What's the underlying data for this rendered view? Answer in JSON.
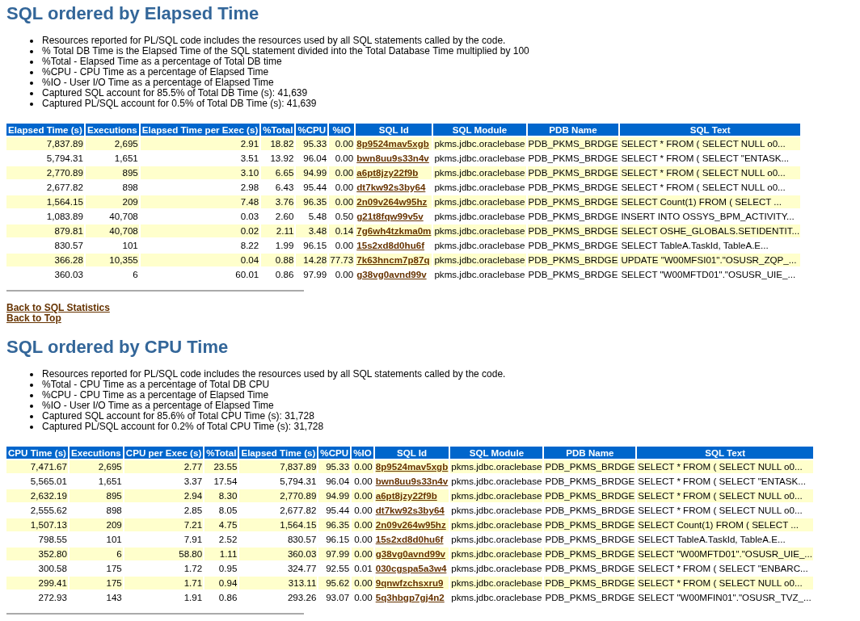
{
  "sections": [
    {
      "title": "SQL ordered by Elapsed Time",
      "notes": [
        "Resources reported for PL/SQL code includes the resources used by all SQL statements called by the code.",
        "% Total DB Time is the Elapsed Time of the SQL statement divided into the Total Database Time multiplied by 100",
        "%Total - Elapsed Time as a percentage of Total DB time",
        "%CPU - CPU Time as a percentage of Elapsed Time",
        "%IO - User I/O Time as a percentage of Elapsed Time",
        "Captured SQL account for 85.5% of Total DB Time (s): 41,639",
        "Captured PL/SQL account for 0.5% of Total DB Time (s): 41,639"
      ],
      "table": {
        "columns": [
          {
            "label": "Elapsed Time (s)",
            "kind": "number"
          },
          {
            "label": "Executions",
            "kind": "number"
          },
          {
            "label": "Elapsed Time per Exec (s)",
            "kind": "number"
          },
          {
            "label": "%Total",
            "kind": "number"
          },
          {
            "label": "%CPU",
            "kind": "number"
          },
          {
            "label": "%IO",
            "kind": "number"
          },
          {
            "label": "SQL Id",
            "kind": "link"
          },
          {
            "label": "SQL Module",
            "kind": "text"
          },
          {
            "label": "PDB Name",
            "kind": "text"
          },
          {
            "label": "SQL Text",
            "kind": "text"
          }
        ],
        "rows": [
          [
            "7,837.89",
            "2,695",
            "2.91",
            "18.82",
            "95.33",
            "0.00",
            "8p9524mav5xgb",
            "pkms.jdbc.oraclebase",
            "PDB_PKMS_BRDGE",
            "SELECT * FROM ( SELECT NULL o0..."
          ],
          [
            "5,794.31",
            "1,651",
            "3.51",
            "13.92",
            "96.04",
            "0.00",
            "bwn8uu9s33n4v",
            "pkms.jdbc.oraclebase",
            "PDB_PKMS_BRDGE",
            "SELECT * FROM ( SELECT \"ENTASK..."
          ],
          [
            "2,770.89",
            "895",
            "3.10",
            "6.65",
            "94.99",
            "0.00",
            "a6pt8jzy22f9b",
            "pkms.jdbc.oraclebase",
            "PDB_PKMS_BRDGE",
            "SELECT * FROM ( SELECT NULL o0..."
          ],
          [
            "2,677.82",
            "898",
            "2.98",
            "6.43",
            "95.44",
            "0.00",
            "dt7kw92s3by64",
            "pkms.jdbc.oraclebase",
            "PDB_PKMS_BRDGE",
            "SELECT * FROM ( SELECT NULL o0..."
          ],
          [
            "1,564.15",
            "209",
            "7.48",
            "3.76",
            "96.35",
            "0.00",
            "2n09v264w95hz",
            "pkms.jdbc.oraclebase",
            "PDB_PKMS_BRDGE",
            "SELECT Count(1) FROM ( SELECT ..."
          ],
          [
            "1,083.89",
            "40,708",
            "0.03",
            "2.60",
            "5.48",
            "0.50",
            "g21t8fqw99v5v",
            "pkms.jdbc.oraclebase",
            "PDB_PKMS_BRDGE",
            "INSERT INTO OSSYS_BPM_ACTIVITY..."
          ],
          [
            "879.81",
            "40,708",
            "0.02",
            "2.11",
            "3.48",
            "0.14",
            "7g6wh4tzkma0m",
            "pkms.jdbc.oraclebase",
            "PDB_PKMS_BRDGE",
            "SELECT OSHE_GLOBALS.SETIDENTIT..."
          ],
          [
            "830.57",
            "101",
            "8.22",
            "1.99",
            "96.15",
            "0.00",
            "15s2xd8d0hu6f",
            "pkms.jdbc.oraclebase",
            "PDB_PKMS_BRDGE",
            "SELECT TableA.TaskId, TableA.E..."
          ],
          [
            "366.28",
            "10,355",
            "0.04",
            "0.88",
            "14.28",
            "77.73",
            "7k63hncm7p87q",
            "pkms.jdbc.oraclebase",
            "PDB_PKMS_BRDGE",
            "UPDATE \"W00MFSI01\".\"OSUSR_ZQP_..."
          ],
          [
            "360.03",
            "6",
            "60.01",
            "0.86",
            "97.99",
            "0.00",
            "g38vg0avnd99v",
            "pkms.jdbc.oraclebase",
            "PDB_PKMS_BRDGE",
            "SELECT \"W00MFTD01\".\"OSUSR_UIE_..."
          ]
        ]
      },
      "links": [
        "Back to SQL Statistics",
        "Back to Top"
      ]
    },
    {
      "title": "SQL ordered by CPU Time",
      "notes": [
        "Resources reported for PL/SQL code includes the resources used by all SQL statements called by the code.",
        "%Total - CPU Time as a percentage of Total DB CPU",
        "%CPU - CPU Time as a percentage of Elapsed Time",
        "%IO - User I/O Time as a percentage of Elapsed Time",
        "Captured SQL account for 85.6% of Total CPU Time (s): 31,728",
        "Captured PL/SQL account for 0.2% of Total CPU Time (s): 31,728"
      ],
      "table": {
        "columns": [
          {
            "label": "CPU Time (s)",
            "kind": "number"
          },
          {
            "label": "Executions",
            "kind": "number"
          },
          {
            "label": "CPU per Exec (s)",
            "kind": "number"
          },
          {
            "label": "%Total",
            "kind": "number"
          },
          {
            "label": "Elapsed Time (s)",
            "kind": "number"
          },
          {
            "label": "%CPU",
            "kind": "number"
          },
          {
            "label": "%IO",
            "kind": "number"
          },
          {
            "label": "SQL Id",
            "kind": "link"
          },
          {
            "label": "SQL Module",
            "kind": "text"
          },
          {
            "label": "PDB Name",
            "kind": "text"
          },
          {
            "label": "SQL Text",
            "kind": "text"
          }
        ],
        "rows": [
          [
            "7,471.67",
            "2,695",
            "2.77",
            "23.55",
            "7,837.89",
            "95.33",
            "0.00",
            "8p9524mav5xgb",
            "pkms.jdbc.oraclebase",
            "PDB_PKMS_BRDGE",
            "SELECT * FROM ( SELECT NULL o0..."
          ],
          [
            "5,565.01",
            "1,651",
            "3.37",
            "17.54",
            "5,794.31",
            "96.04",
            "0.00",
            "bwn8uu9s33n4v",
            "pkms.jdbc.oraclebase",
            "PDB_PKMS_BRDGE",
            "SELECT * FROM ( SELECT \"ENTASK..."
          ],
          [
            "2,632.19",
            "895",
            "2.94",
            "8.30",
            "2,770.89",
            "94.99",
            "0.00",
            "a6pt8jzy22f9b",
            "pkms.jdbc.oraclebase",
            "PDB_PKMS_BRDGE",
            "SELECT * FROM ( SELECT NULL o0..."
          ],
          [
            "2,555.62",
            "898",
            "2.85",
            "8.05",
            "2,677.82",
            "95.44",
            "0.00",
            "dt7kw92s3by64",
            "pkms.jdbc.oraclebase",
            "PDB_PKMS_BRDGE",
            "SELECT * FROM ( SELECT NULL o0..."
          ],
          [
            "1,507.13",
            "209",
            "7.21",
            "4.75",
            "1,564.15",
            "96.35",
            "0.00",
            "2n09v264w95hz",
            "pkms.jdbc.oraclebase",
            "PDB_PKMS_BRDGE",
            "SELECT Count(1) FROM ( SELECT ..."
          ],
          [
            "798.55",
            "101",
            "7.91",
            "2.52",
            "830.57",
            "96.15",
            "0.00",
            "15s2xd8d0hu6f",
            "pkms.jdbc.oraclebase",
            "PDB_PKMS_BRDGE",
            "SELECT TableA.TaskId, TableA.E..."
          ],
          [
            "352.80",
            "6",
            "58.80",
            "1.11",
            "360.03",
            "97.99",
            "0.00",
            "g38vg0avnd99v",
            "pkms.jdbc.oraclebase",
            "PDB_PKMS_BRDGE",
            "SELECT \"W00MFTD01\".\"OSUSR_UIE_..."
          ],
          [
            "300.58",
            "175",
            "1.72",
            "0.95",
            "324.77",
            "92.55",
            "0.01",
            "030cgspa5a3w4",
            "pkms.jdbc.oraclebase",
            "PDB_PKMS_BRDGE",
            "SELECT * FROM ( SELECT \"ENBARC..."
          ],
          [
            "299.41",
            "175",
            "1.71",
            "0.94",
            "313.11",
            "95.62",
            "0.00",
            "9qnwfzchsxru9",
            "pkms.jdbc.oraclebase",
            "PDB_PKMS_BRDGE",
            "SELECT * FROM ( SELECT NULL o0..."
          ],
          [
            "272.93",
            "143",
            "1.91",
            "0.86",
            "293.26",
            "93.07",
            "0.00",
            "5q3hbgp7gj4n2",
            "pkms.jdbc.oraclebase",
            "PDB_PKMS_BRDGE",
            "SELECT \"W00MFIN01\".\"OSUSR_TVZ_..."
          ]
        ]
      }
    }
  ]
}
